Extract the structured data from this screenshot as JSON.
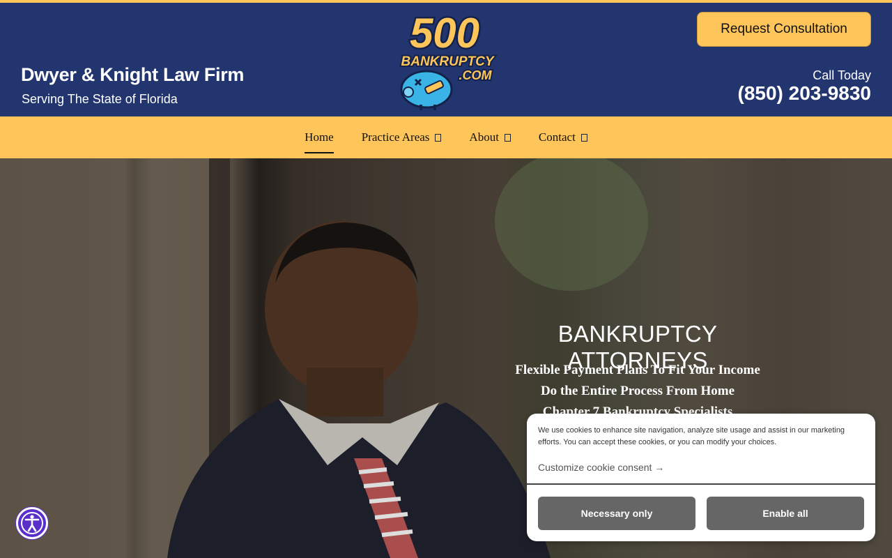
{
  "header": {
    "firm_name": "Dwyer & Knight Law Firm",
    "firm_tagline": "Serving The State of Florida",
    "logo_number": "500",
    "logo_word": "BANKRUPTCY",
    "logo_suffix": ".COM",
    "consult_button": "Request Consultation",
    "call_label": "Call Today",
    "phone": "(850) 203-9830"
  },
  "nav": {
    "items": [
      {
        "label": "Home",
        "active": true
      },
      {
        "label": "Practice Areas"
      },
      {
        "label": "About"
      },
      {
        "label": "Contact"
      }
    ]
  },
  "hero": {
    "title": "BANKRUPTCY ATTORNEYS",
    "lines": [
      "Flexible Payment Plans To Fit Your Income",
      "Do the Entire Process From Home",
      "Chapter 7 Bankruptcy Specialists"
    ]
  },
  "cookie": {
    "message": "We use cookies to enhance site navigation, analyze site usage and assist in our marketing efforts. You can accept these cookies, or you can modify your choices.",
    "customize_link": "Customize cookie consent →",
    "necessary_button": "Necessary only",
    "enable_button": "Enable all"
  },
  "colors": {
    "header_bg": "#22356f",
    "accent": "#fec55a",
    "button_gray": "#666666",
    "a11y_purple": "#5b2fc9"
  },
  "icons": [
    "chevron-down-icon",
    "accessibility-icon",
    "arrow-right-icon",
    "piggy-bank-icon"
  ]
}
